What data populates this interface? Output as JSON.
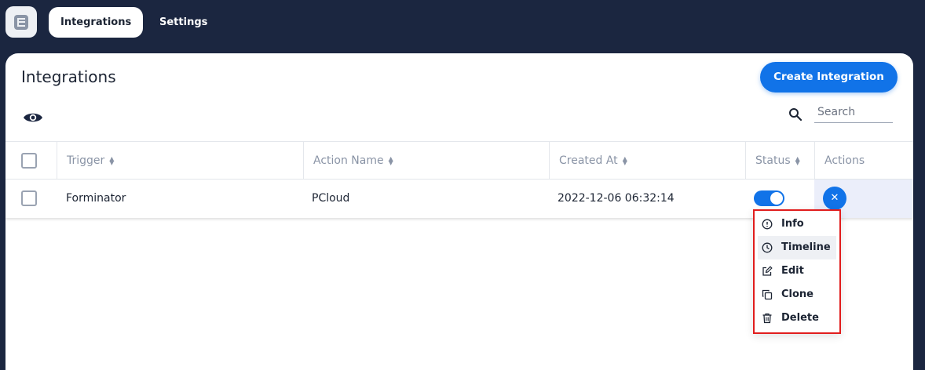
{
  "nav": {
    "logo_icon": "app-logo-icon",
    "tabs": [
      {
        "label": "Integrations",
        "active": true
      },
      {
        "label": "Settings",
        "active": false
      }
    ]
  },
  "page": {
    "title": "Integrations",
    "create_button": "Create Integration",
    "search_placeholder": "Search",
    "search_value": ""
  },
  "table": {
    "columns": [
      "Trigger",
      "Action Name",
      "Created At",
      "Status",
      "Actions"
    ],
    "rows": [
      {
        "trigger": "Forminator",
        "action_name": "PCloud",
        "created_at": "2022-12-06 06:32:14",
        "status": "on"
      }
    ]
  },
  "actions_menu": {
    "items": [
      {
        "label": "Info",
        "icon": "info-icon"
      },
      {
        "label": "Timeline",
        "icon": "clock-icon"
      },
      {
        "label": "Edit",
        "icon": "edit-icon"
      },
      {
        "label": "Clone",
        "icon": "clone-icon"
      },
      {
        "label": "Delete",
        "icon": "trash-icon"
      }
    ]
  },
  "colors": {
    "nav_bg": "#1b2640",
    "accent": "#1173e8",
    "highlight_border": "#e11d1d"
  }
}
